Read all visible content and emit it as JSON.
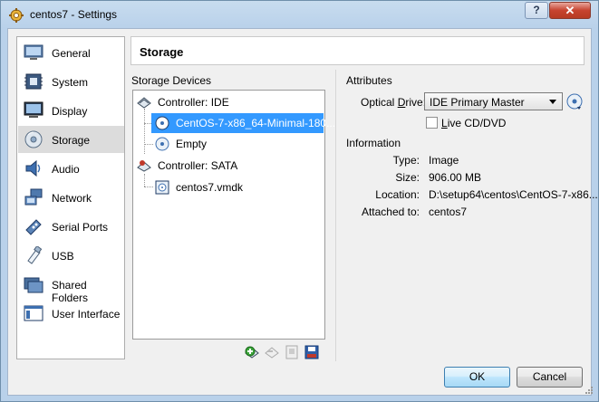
{
  "window": {
    "title": "centos7 - Settings",
    "help_label": "?",
    "close_label": "✕"
  },
  "sidebar": {
    "items": [
      {
        "label": "General",
        "icon": "general-icon"
      },
      {
        "label": "System",
        "icon": "system-icon"
      },
      {
        "label": "Display",
        "icon": "display-icon"
      },
      {
        "label": "Storage",
        "icon": "storage-icon",
        "selected": true
      },
      {
        "label": "Audio",
        "icon": "audio-icon"
      },
      {
        "label": "Network",
        "icon": "network-icon"
      },
      {
        "label": "Serial Ports",
        "icon": "serial-ports-icon"
      },
      {
        "label": "USB",
        "icon": "usb-icon"
      },
      {
        "label": "Shared Folders",
        "icon": "shared-folders-icon"
      },
      {
        "label": "User Interface",
        "icon": "user-interface-icon"
      }
    ]
  },
  "page": {
    "title": "Storage"
  },
  "storage_devices": {
    "label": "Storage Devices",
    "controller_ide": "Controller: IDE",
    "ide_disc": "CentOS-7-x86_64-Minimal-180...",
    "ide_empty": "Empty",
    "controller_sata": "Controller: SATA",
    "sata_disk": "centos7.vmdk"
  },
  "attributes": {
    "label": "Attributes",
    "optical_label_pre": "Optical ",
    "optical_label_key": "D",
    "optical_label_post": "rive:",
    "optical_value": "IDE Primary Master",
    "live_key": "L",
    "live_rest": "ive CD/DVD"
  },
  "information": {
    "label": "Information",
    "type_key": "Type:",
    "type_val": "Image",
    "size_key": "Size:",
    "size_val": "906.00 MB",
    "location_key": "Location:",
    "location_val": "D:\\setup64\\centos\\CentOS-7-x86...",
    "attached_key": "Attached to:",
    "attached_val": "centos7"
  },
  "buttons": {
    "ok": "OK",
    "cancel": "Cancel"
  },
  "colors": {
    "selection": "#3399ff",
    "title_bar": "#b9d1ea"
  }
}
